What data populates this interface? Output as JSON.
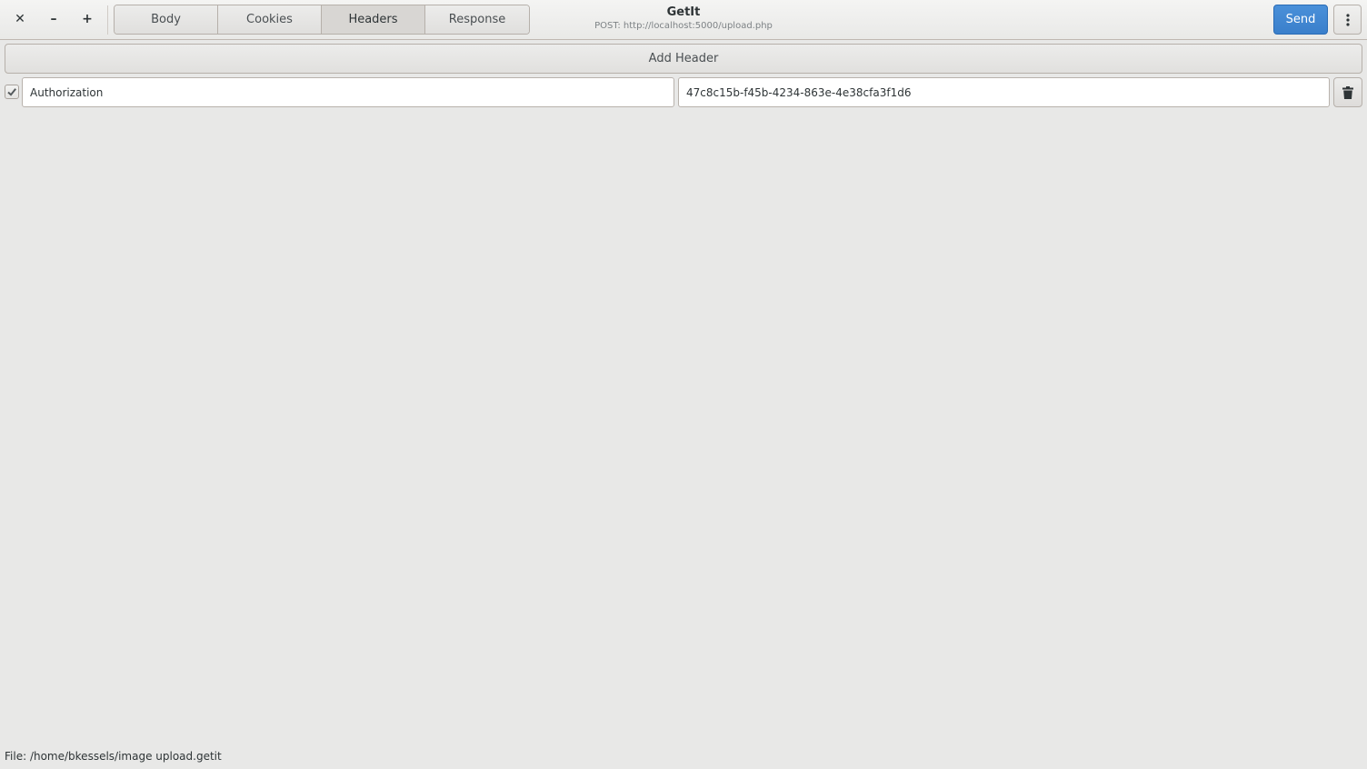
{
  "window_controls": {
    "close_glyph": "✕",
    "minimize_glyph": "–",
    "maximize_glyph": "+"
  },
  "tabs": [
    {
      "label": "Body",
      "active": false
    },
    {
      "label": "Cookies",
      "active": false
    },
    {
      "label": "Headers",
      "active": true
    },
    {
      "label": "Response",
      "active": false
    }
  ],
  "header": {
    "title": "GetIt",
    "subtitle": "POST: http://localhost:5000/upload.php",
    "send_label": "Send",
    "menu_icon": "vertical-ellipsis-icon"
  },
  "add_header_label": "Add Header",
  "headers": [
    {
      "enabled": true,
      "name": "Authorization",
      "value": "47c8c15b-f45b-4234-863e-4e38cfa3f1d6",
      "delete_icon": "trash-icon"
    }
  ],
  "status": {
    "file_text": "File: /home/bkessels/image upload.getit"
  },
  "colors": {
    "accent": "#3a84d5",
    "background": "#e8e8e7"
  }
}
